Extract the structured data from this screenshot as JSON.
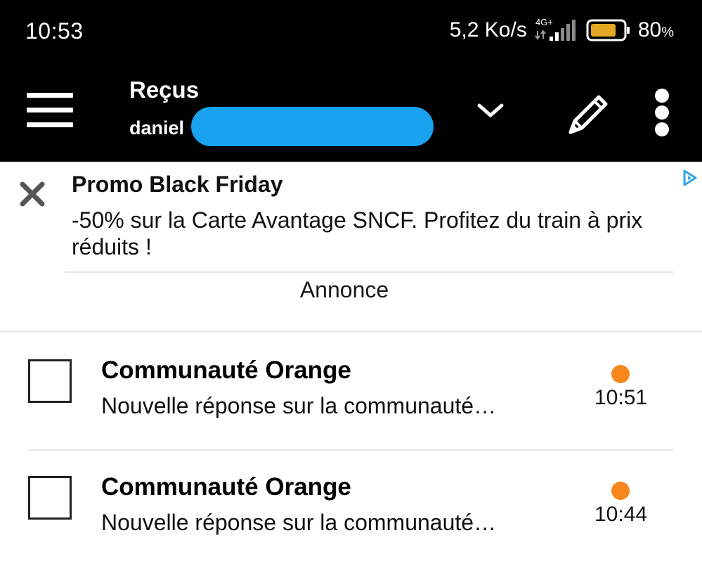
{
  "status_bar": {
    "time": "10:53",
    "net_speed": "5,2 Ko/s",
    "network_type": "4G+",
    "battery_percent": "80",
    "battery_unit": "%",
    "battery_level": 0.8,
    "battery_color": "#e3a823",
    "icons": [
      "signal-icon",
      "battery-icon"
    ]
  },
  "header": {
    "folder_title": "Reçus",
    "account_prefix": "daniel",
    "account_redacted": true,
    "redaction_color": "#18a2f0",
    "icons": [
      "menu-icon",
      "chevron-down-icon",
      "pencil-icon",
      "more-vertical-icon"
    ]
  },
  "ad": {
    "title": "Promo Black Friday",
    "text": "-50% sur la Carte Avantage SNCF. Profitez du train à prix réduits !",
    "label": "Annonce",
    "icons": [
      "close-icon",
      "adchoices-icon"
    ],
    "adchoices_color": "#2fa4e7"
  },
  "mails": [
    {
      "sender": "Communauté Orange",
      "subject": "Nouvelle réponse sur la communauté…",
      "time": "10:51",
      "unread": true
    },
    {
      "sender": "Communauté Orange",
      "subject": "Nouvelle réponse sur la communauté…",
      "time": "10:44",
      "unread": true
    }
  ],
  "colors": {
    "bar_bg": "#000000",
    "unread_dot": "#f7861c"
  }
}
